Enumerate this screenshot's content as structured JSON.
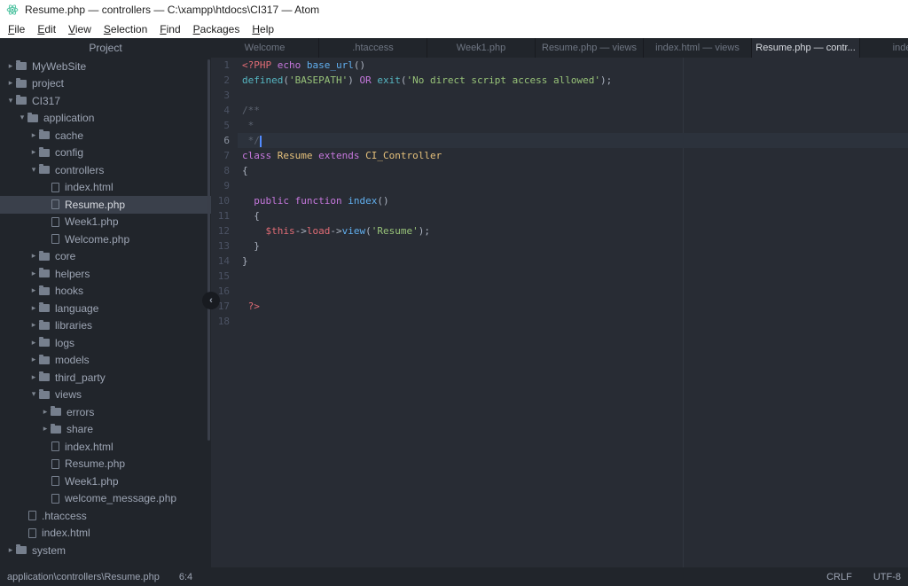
{
  "title_bar": {
    "title": "Resume.php — controllers — C:\\xampp\\htdocs\\CI317 — Atom"
  },
  "menu": {
    "items": [
      "File",
      "Edit",
      "View",
      "Selection",
      "Find",
      "Packages",
      "Help"
    ]
  },
  "tree": {
    "header": "Project",
    "items": [
      {
        "label": "MyWebSite",
        "depth": 0,
        "kind": "folder",
        "state": "collapsed"
      },
      {
        "label": "project",
        "depth": 0,
        "kind": "folder",
        "state": "collapsed"
      },
      {
        "label": "CI317",
        "depth": 0,
        "kind": "folder",
        "state": "expanded"
      },
      {
        "label": "application",
        "depth": 1,
        "kind": "folder",
        "state": "expanded"
      },
      {
        "label": "cache",
        "depth": 2,
        "kind": "folder",
        "state": "collapsed"
      },
      {
        "label": "config",
        "depth": 2,
        "kind": "folder",
        "state": "collapsed"
      },
      {
        "label": "controllers",
        "depth": 2,
        "kind": "folder",
        "state": "expanded"
      },
      {
        "label": "index.html",
        "depth": 3,
        "kind": "file"
      },
      {
        "label": "Resume.php",
        "depth": 3,
        "kind": "file",
        "selected": true
      },
      {
        "label": "Week1.php",
        "depth": 3,
        "kind": "file"
      },
      {
        "label": "Welcome.php",
        "depth": 3,
        "kind": "file"
      },
      {
        "label": "core",
        "depth": 2,
        "kind": "folder",
        "state": "collapsed"
      },
      {
        "label": "helpers",
        "depth": 2,
        "kind": "folder",
        "state": "collapsed"
      },
      {
        "label": "hooks",
        "depth": 2,
        "kind": "folder",
        "state": "collapsed"
      },
      {
        "label": "language",
        "depth": 2,
        "kind": "folder",
        "state": "collapsed"
      },
      {
        "label": "libraries",
        "depth": 2,
        "kind": "folder",
        "state": "collapsed"
      },
      {
        "label": "logs",
        "depth": 2,
        "kind": "folder",
        "state": "collapsed"
      },
      {
        "label": "models",
        "depth": 2,
        "kind": "folder",
        "state": "collapsed"
      },
      {
        "label": "third_party",
        "depth": 2,
        "kind": "folder",
        "state": "collapsed"
      },
      {
        "label": "views",
        "depth": 2,
        "kind": "folder",
        "state": "expanded"
      },
      {
        "label": "errors",
        "depth": 3,
        "kind": "folder",
        "state": "collapsed"
      },
      {
        "label": "share",
        "depth": 3,
        "kind": "folder",
        "state": "collapsed"
      },
      {
        "label": "index.html",
        "depth": 3,
        "kind": "file"
      },
      {
        "label": "Resume.php",
        "depth": 3,
        "kind": "file"
      },
      {
        "label": "Week1.php",
        "depth": 3,
        "kind": "file"
      },
      {
        "label": "welcome_message.php",
        "depth": 3,
        "kind": "file"
      },
      {
        "label": ".htaccess",
        "depth": 1,
        "kind": "file"
      },
      {
        "label": "index.html",
        "depth": 1,
        "kind": "file"
      },
      {
        "label": "system",
        "depth": 0,
        "kind": "folder",
        "state": "collapsed"
      }
    ]
  },
  "tabs": [
    {
      "label": "Welcome"
    },
    {
      "label": ".htaccess"
    },
    {
      "label": "Week1.php"
    },
    {
      "label": "Resume.php — views"
    },
    {
      "label": "index.html — views"
    },
    {
      "label": "Resume.php — contr...",
      "active": true
    },
    {
      "label": "index.htm"
    }
  ],
  "editor": {
    "active_line": 6,
    "cursor": {
      "line": 6,
      "column": 4
    },
    "lines": [
      [
        {
          "t": "<?PHP",
          "c": "red"
        },
        {
          "t": " "
        },
        {
          "t": "echo",
          "c": "purple"
        },
        {
          "t": " "
        },
        {
          "t": "base_url",
          "c": "blue"
        },
        {
          "t": "()"
        }
      ],
      [
        {
          "t": "defined",
          "c": "cyan"
        },
        {
          "t": "("
        },
        {
          "t": "'BASEPATH'",
          "c": "green"
        },
        {
          "t": ") "
        },
        {
          "t": "OR",
          "c": "purple"
        },
        {
          "t": " "
        },
        {
          "t": "exit",
          "c": "cyan"
        },
        {
          "t": "("
        },
        {
          "t": "'No direct script access allowed'",
          "c": "green"
        },
        {
          "t": ");"
        }
      ],
      [],
      [
        {
          "t": "/**",
          "c": "comment"
        }
      ],
      [
        {
          "t": " *",
          "c": "comment"
        }
      ],
      [
        {
          "t": " */",
          "c": "comment"
        }
      ],
      [
        {
          "t": "class",
          "c": "purple"
        },
        {
          "t": " "
        },
        {
          "t": "Resume",
          "c": "yellow"
        },
        {
          "t": " "
        },
        {
          "t": "extends",
          "c": "purple"
        },
        {
          "t": " "
        },
        {
          "t": "CI_Controller",
          "c": "yellow"
        }
      ],
      [
        {
          "t": "{"
        }
      ],
      [],
      [
        {
          "t": "  "
        },
        {
          "t": "public",
          "c": "purple"
        },
        {
          "t": " "
        },
        {
          "t": "function",
          "c": "purple"
        },
        {
          "t": " "
        },
        {
          "t": "index",
          "c": "blue"
        },
        {
          "t": "()"
        }
      ],
      [
        {
          "t": "  {"
        }
      ],
      [
        {
          "t": "    "
        },
        {
          "t": "$this",
          "c": "red"
        },
        {
          "t": "->"
        },
        {
          "t": "load",
          "c": "red"
        },
        {
          "t": "->"
        },
        {
          "t": "view",
          "c": "blue"
        },
        {
          "t": "("
        },
        {
          "t": "'Resume'",
          "c": "green"
        },
        {
          "t": ");"
        }
      ],
      [
        {
          "t": "  }"
        }
      ],
      [
        {
          "t": "}"
        }
      ],
      [],
      [],
      [
        {
          "t": " ?>",
          "c": "red"
        }
      ],
      []
    ]
  },
  "status": {
    "path": "application\\controllers\\Resume.php",
    "position": "6:4",
    "line_ending": "CRLF",
    "encoding": "UTF-8"
  },
  "colors": {
    "background": "#282c34",
    "panel": "#21252b",
    "selection": "#3a404b",
    "accent": "#528bff",
    "logo": "#4fc3a1"
  }
}
